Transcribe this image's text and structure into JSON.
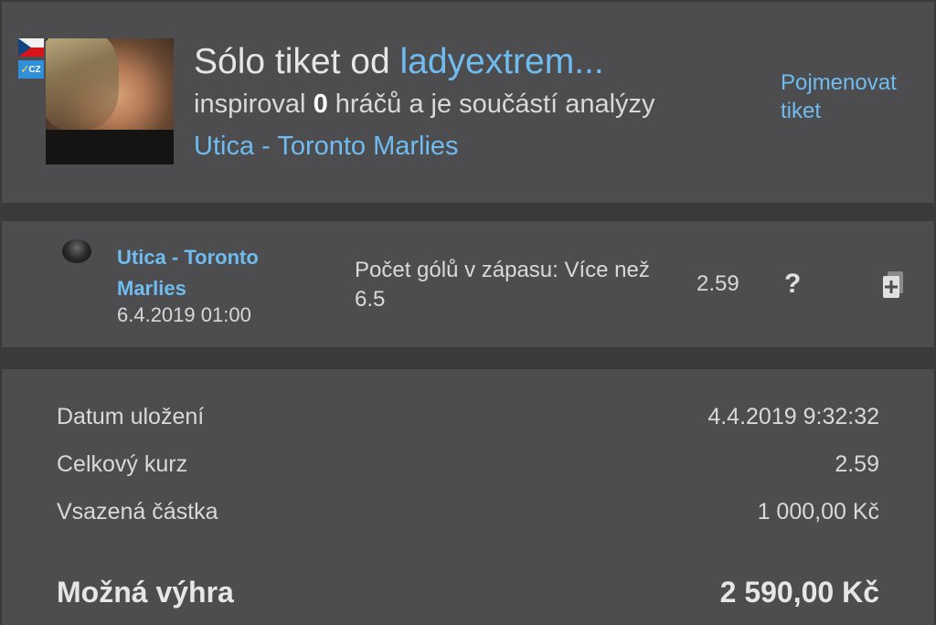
{
  "header": {
    "title_prefix": "Sólo tiket od ",
    "username": "ladyextrem...",
    "sub_prefix": "inspiroval ",
    "inspired_count": "0",
    "sub_suffix": " hráčů a je součástí analýzy",
    "match": "Utica - Toronto Marlies",
    "rename_label": "Pojmenovat tiket",
    "lang_badge": "CZ",
    "flag": "czech-flag",
    "colors": {
      "link": "#6fbcf0",
      "background": "#4d4d4f",
      "separator": "#3a3a3b"
    }
  },
  "bet": {
    "icon": "hockey-puck-icon",
    "match": "Utica - Toronto Marlies",
    "date": "6.4.2019 01:00",
    "bet_type": "Počet gólů v zápasu: Více než 6.5",
    "odds": "2.59",
    "help_icon": "?",
    "add_icon": "add-ticket-icon"
  },
  "summary": {
    "rows": [
      {
        "label": "Datum uložení",
        "value": "4.4.2019 9:32:32"
      },
      {
        "label": "Celkový kurz",
        "value": "2.59"
      },
      {
        "label": "Vsazená částka",
        "value": "1 000,00 Kč"
      }
    ],
    "win_label": "Možná výhra",
    "win_value": "2 590,00 Kč"
  }
}
